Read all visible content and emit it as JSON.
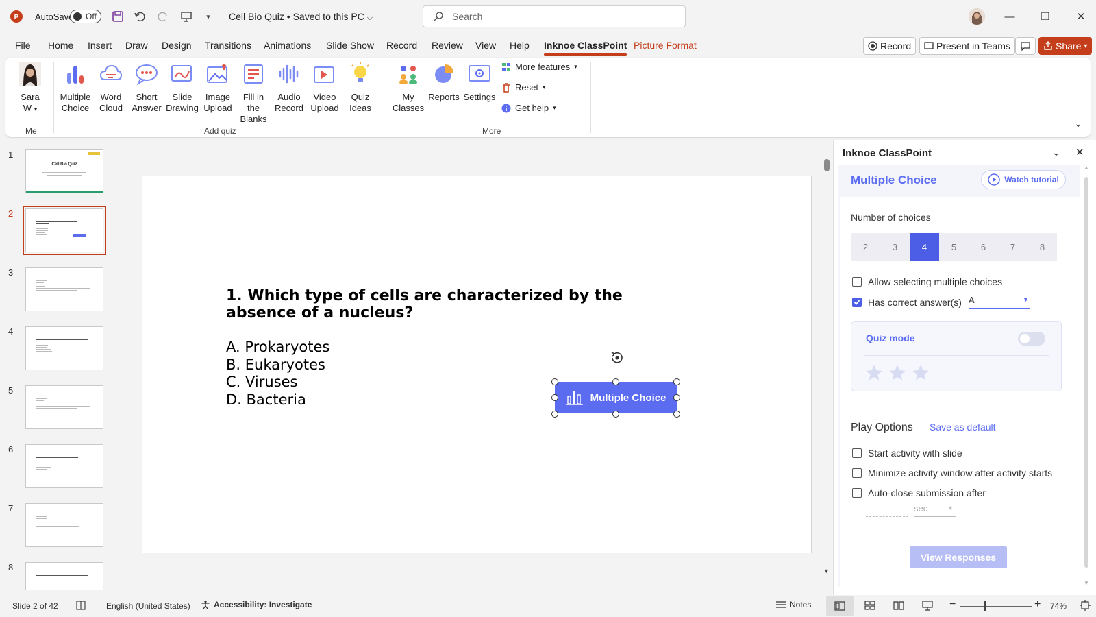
{
  "titlebar": {
    "autosave_label": "AutoSave",
    "autosave_state": "Off",
    "doc_title": "Cell Bio Quiz • Saved to this PC",
    "search_placeholder": "Search"
  },
  "tabs": [
    "File",
    "Home",
    "Insert",
    "Draw",
    "Design",
    "Transitions",
    "Animations",
    "Slide Show",
    "Record",
    "Review",
    "View",
    "Help",
    "Inknoe ClassPoint",
    "Picture Format"
  ],
  "active_tab": "Inknoe ClassPoint",
  "top_buttons": {
    "record": "Record",
    "present_teams": "Present in Teams",
    "share": "Share"
  },
  "ribbon": {
    "me": {
      "name_line1": "Sara",
      "name_line2": "W",
      "group": "Me"
    },
    "add_quiz": [
      {
        "l1": "Multiple",
        "l2": "Choice"
      },
      {
        "l1": "Word",
        "l2": "Cloud"
      },
      {
        "l1": "Short",
        "l2": "Answer"
      },
      {
        "l1": "Slide",
        "l2": "Drawing"
      },
      {
        "l1": "Image",
        "l2": "Upload"
      },
      {
        "l1": "Fill in the",
        "l2": "Blanks"
      },
      {
        "l1": "Audio",
        "l2": "Record"
      },
      {
        "l1": "Video",
        "l2": "Upload"
      },
      {
        "l1": "Quiz",
        "l2": "Ideas"
      }
    ],
    "add_quiz_group": "Add quiz",
    "more": [
      {
        "l1": "My",
        "l2": "Classes"
      },
      {
        "l1": "Reports",
        "l2": ""
      },
      {
        "l1": "Settings",
        "l2": ""
      }
    ],
    "more_small": [
      "More features",
      "Reset",
      "Get help"
    ],
    "more_group": "More"
  },
  "thumbnails": {
    "numbers": [
      "1",
      "2",
      "3",
      "4",
      "5",
      "6",
      "7",
      "8"
    ],
    "first_title": "Cell Bio Quiz"
  },
  "slide": {
    "question": "1. Which type of cells are characterized by the absence of a nucleus?",
    "options": [
      "A. Prokaryotes",
      "B. Eukaryotes",
      "C. Viruses",
      "D. Bacteria"
    ],
    "button_label": "Multiple Choice"
  },
  "panel": {
    "title": "Inknoe ClassPoint",
    "heading": "Multiple Choice",
    "watch_tutorial": "Watch tutorial",
    "num_choices_label": "Number of choices",
    "choices": [
      "2",
      "3",
      "4",
      "5",
      "6",
      "7",
      "8"
    ],
    "selected_choice": "4",
    "allow_multiple": "Allow selecting multiple choices",
    "has_correct": "Has correct answer(s)",
    "correct_answer": "A",
    "quiz_mode": "Quiz mode",
    "stars": 3,
    "play_options": "Play Options",
    "save_default": "Save as default",
    "start_with_slide": "Start activity with slide",
    "minimize_window": "Minimize activity window after activity starts",
    "auto_close": "Auto-close submission after",
    "sec_unit": "sec",
    "view_responses": "View Responses"
  },
  "status": {
    "slide_info": "Slide 2 of 42",
    "language": "English (United States)",
    "accessibility": "Accessibility: Investigate",
    "notes": "Notes",
    "zoom": "74%"
  },
  "colors": {
    "accent": "#c43e1c",
    "classpoint": "#5b6cf0"
  }
}
